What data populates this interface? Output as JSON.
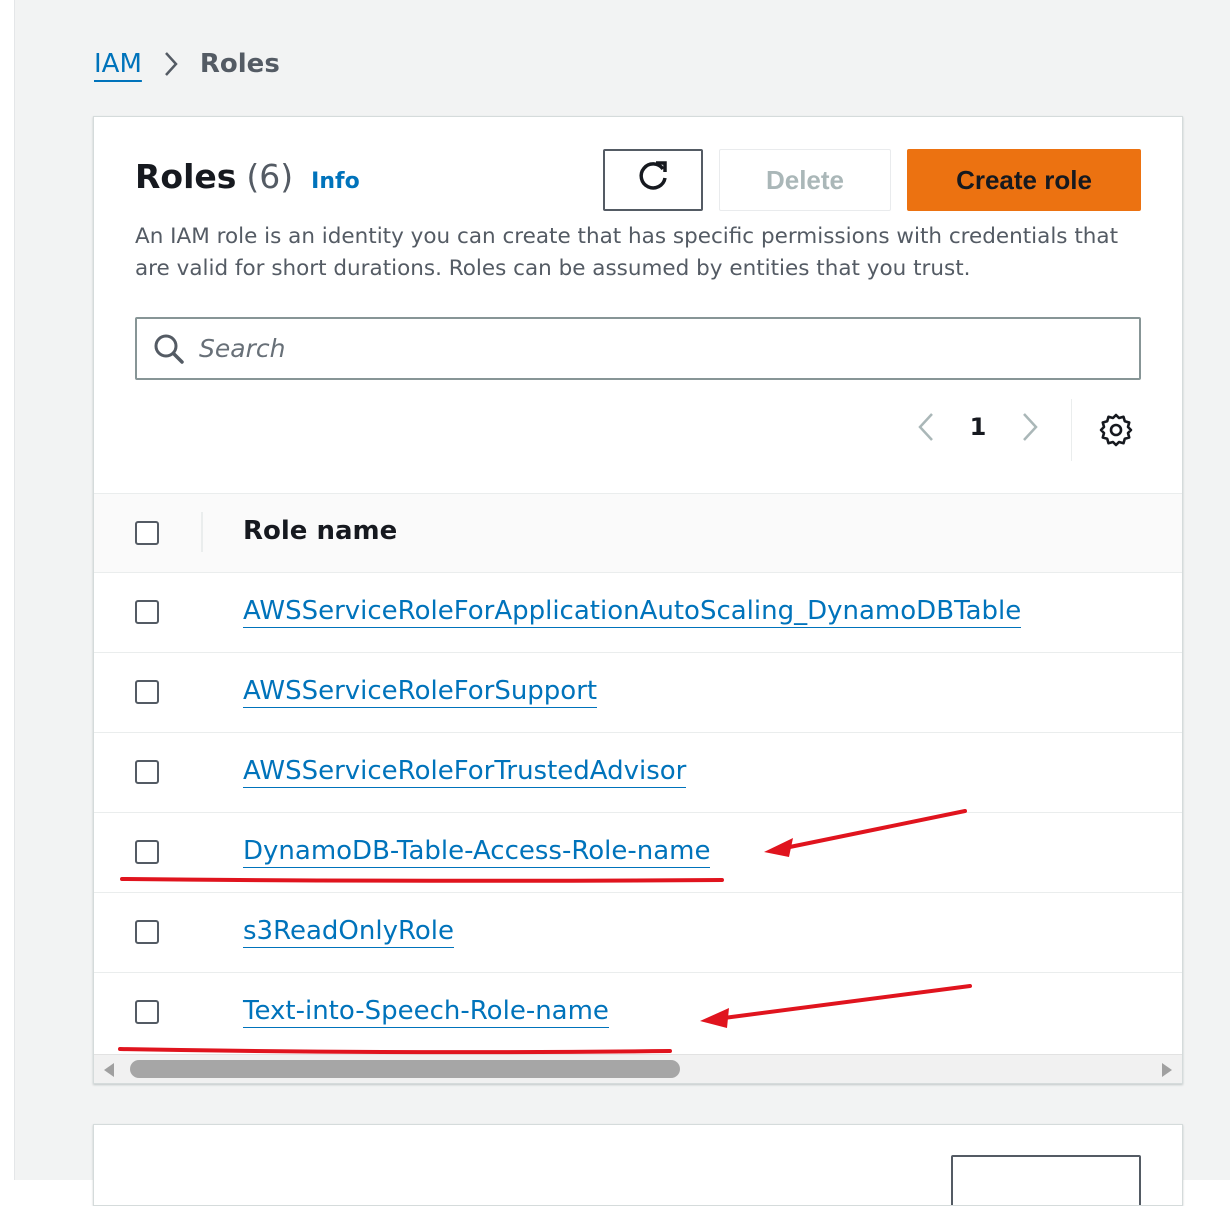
{
  "breadcrumb": {
    "root": "IAM",
    "current": "Roles"
  },
  "header": {
    "title": "Roles",
    "count": "(6)",
    "info": "Info",
    "description": "An IAM role is an identity you can create that has specific permissions with credentials that are valid for short durations. Roles can be assumed by entities that you trust."
  },
  "actions": {
    "refresh_icon": "refresh-icon",
    "delete_label": "Delete",
    "create_label": "Create role"
  },
  "search": {
    "placeholder": "Search",
    "value": ""
  },
  "pagination": {
    "current_page": "1"
  },
  "table": {
    "column_header": "Role name",
    "rows": [
      {
        "name": "AWSServiceRoleForApplicationAutoScaling_DynamoDBTable"
      },
      {
        "name": "AWSServiceRoleForSupport"
      },
      {
        "name": "AWSServiceRoleForTrustedAdvisor"
      },
      {
        "name": "DynamoDB-Table-Access-Role-name"
      },
      {
        "name": "s3ReadOnlyRole"
      },
      {
        "name": "Text-into-Speech-Role-name"
      }
    ]
  },
  "colors": {
    "link": "#0073bb",
    "primary_button": "#ec7211",
    "annotation": "#e0141e"
  }
}
